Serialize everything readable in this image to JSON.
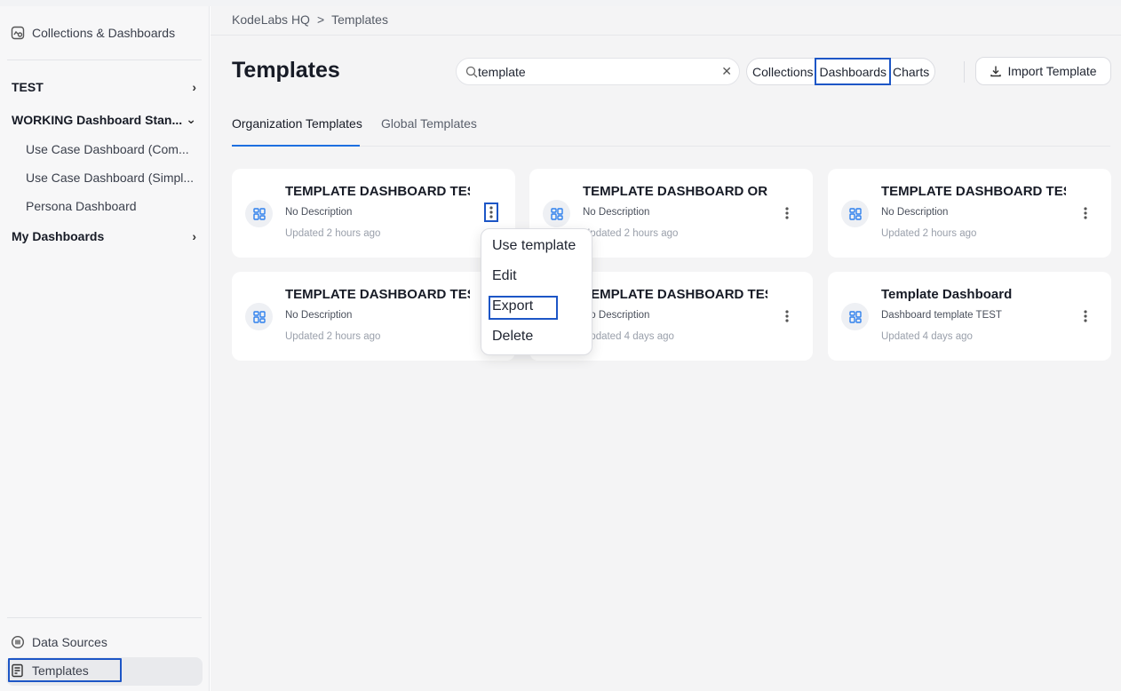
{
  "sidebar": {
    "top_link": "Collections & Dashboards",
    "items": [
      {
        "label": "TEST"
      },
      {
        "label": "WORKING Dashboard Stan..."
      },
      {
        "label": "Use Case Dashboard (Com..."
      },
      {
        "label": "Use Case Dashboard (Simpl..."
      },
      {
        "label": "Persona Dashboard"
      },
      {
        "label": "My Dashboards"
      }
    ],
    "bottom": {
      "data_sources": "Data Sources",
      "templates": "Templates"
    }
  },
  "breadcrumb": {
    "root": "KodeLabs HQ",
    "sep": ">",
    "current": "Templates"
  },
  "page": {
    "title": "Templates"
  },
  "search": {
    "value": "template",
    "placeholder": ""
  },
  "filters": {
    "collections": "Collections",
    "dashboards": "Dashboards",
    "charts": "Charts"
  },
  "import_label": "Import Template",
  "tabs": {
    "org": "Organization Templates",
    "global": "Global Templates"
  },
  "cards": [
    {
      "title": "TEMPLATE DASHBOARD TEST",
      "desc": "No Description",
      "updated": "Updated 2 hours ago"
    },
    {
      "title": "TEMPLATE DASHBOARD ORG",
      "desc": "No Description",
      "updated": "Updated 2 hours ago"
    },
    {
      "title": "TEMPLATE DASHBOARD TEST",
      "desc": "No Description",
      "updated": "Updated 2 hours ago"
    },
    {
      "title": "TEMPLATE DASHBOARD TEST",
      "desc": "No Description",
      "updated": "Updated 2 hours ago"
    },
    {
      "title": "TEMPLATE DASHBOARD TEST",
      "desc": "No Description",
      "updated": "Updated 4 days ago"
    },
    {
      "title": "Template Dashboard",
      "desc": "Dashboard template TEST",
      "updated": "Updated 4 days ago"
    }
  ],
  "context_menu": {
    "use": "Use template",
    "edit": "Edit",
    "export": "Export",
    "delete": "Delete"
  },
  "colors": {
    "accent": "#1d56c6",
    "icon_blue": "#2f80ed"
  }
}
